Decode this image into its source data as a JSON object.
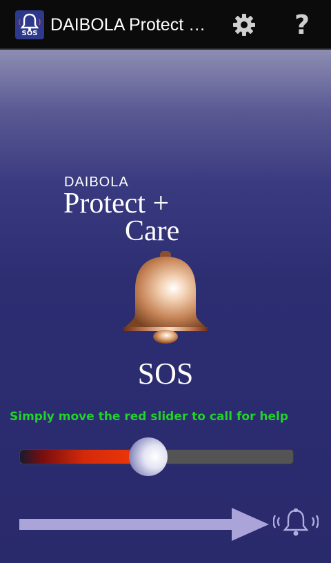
{
  "action_bar": {
    "app_icon_text": "SOS",
    "title": "DAIBOLA Protect + Care",
    "settings_icon": "gear-icon",
    "help_icon_glyph": "?"
  },
  "main": {
    "logo": {
      "brand": "DAIBOLA",
      "line1": "Protect +",
      "line2": "Care"
    },
    "sos_label": "SOS",
    "instruction": "Simply move the red slider to call for help",
    "slider": {
      "value_fraction": 0.47
    },
    "colors": {
      "instruction": "#22d22a",
      "slider_fill": "#f23a08",
      "arrow": "#aaa4d8",
      "bell": "#c98a5e"
    }
  }
}
